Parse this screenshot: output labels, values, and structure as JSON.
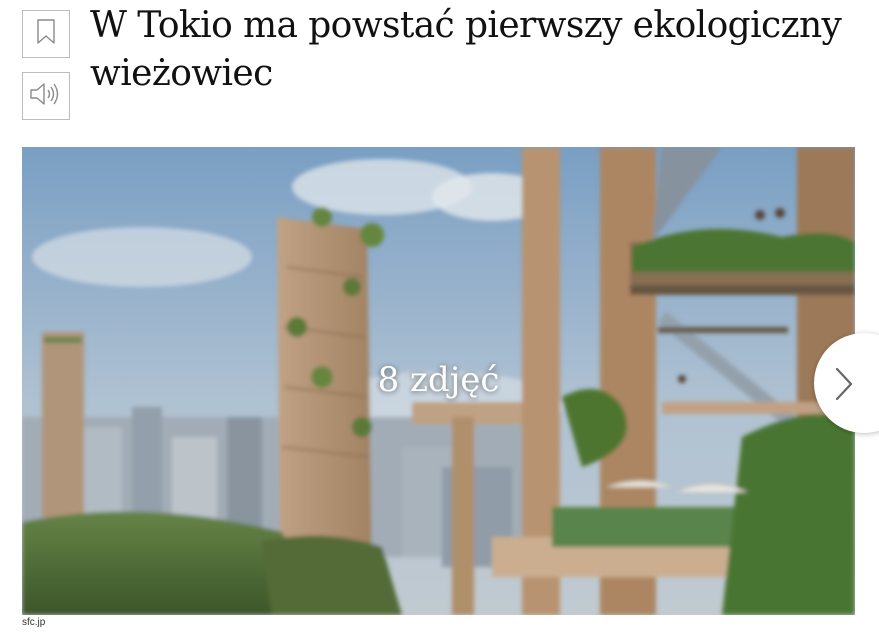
{
  "article": {
    "title": "W Tokio ma powstać pierwszy ekologiczny wieżowiec"
  },
  "actions": {
    "bookmark_icon": "bookmark-icon",
    "audio_icon": "speaker-icon"
  },
  "gallery": {
    "photo_count_label": "8 zdjęć",
    "next_icon": "chevron-right-icon",
    "credit": "sfc.jp"
  }
}
